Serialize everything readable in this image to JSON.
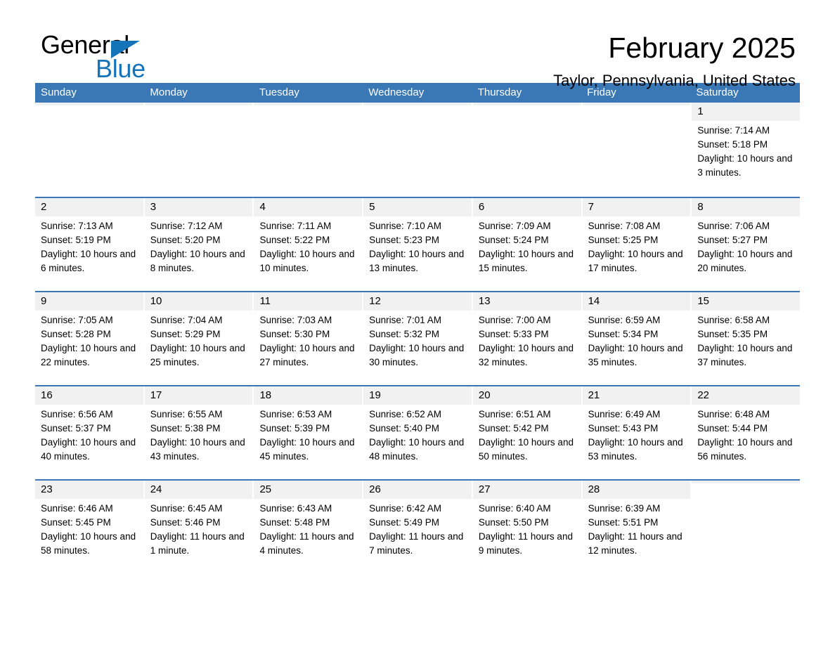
{
  "brand": {
    "name_part1": "General",
    "name_part2": "Blue",
    "accent_color": "#1573b9"
  },
  "header": {
    "title": "February 2025",
    "subtitle": "Taylor, Pennsylvania, United States"
  },
  "calendar": {
    "header_color": "#3a78b5",
    "weekdays": [
      "Sunday",
      "Monday",
      "Tuesday",
      "Wednesday",
      "Thursday",
      "Friday",
      "Saturday"
    ],
    "weeks": [
      [
        {
          "day": "",
          "empty": true
        },
        {
          "day": "",
          "empty": true
        },
        {
          "day": "",
          "empty": true
        },
        {
          "day": "",
          "empty": true
        },
        {
          "day": "",
          "empty": true
        },
        {
          "day": "",
          "empty": true
        },
        {
          "day": "1",
          "sunrise": "Sunrise: 7:14 AM",
          "sunset": "Sunset: 5:18 PM",
          "daylight": "Daylight: 10 hours and 3 minutes."
        }
      ],
      [
        {
          "day": "2",
          "sunrise": "Sunrise: 7:13 AM",
          "sunset": "Sunset: 5:19 PM",
          "daylight": "Daylight: 10 hours and 6 minutes."
        },
        {
          "day": "3",
          "sunrise": "Sunrise: 7:12 AM",
          "sunset": "Sunset: 5:20 PM",
          "daylight": "Daylight: 10 hours and 8 minutes."
        },
        {
          "day": "4",
          "sunrise": "Sunrise: 7:11 AM",
          "sunset": "Sunset: 5:22 PM",
          "daylight": "Daylight: 10 hours and 10 minutes."
        },
        {
          "day": "5",
          "sunrise": "Sunrise: 7:10 AM",
          "sunset": "Sunset: 5:23 PM",
          "daylight": "Daylight: 10 hours and 13 minutes."
        },
        {
          "day": "6",
          "sunrise": "Sunrise: 7:09 AM",
          "sunset": "Sunset: 5:24 PM",
          "daylight": "Daylight: 10 hours and 15 minutes."
        },
        {
          "day": "7",
          "sunrise": "Sunrise: 7:08 AM",
          "sunset": "Sunset: 5:25 PM",
          "daylight": "Daylight: 10 hours and 17 minutes."
        },
        {
          "day": "8",
          "sunrise": "Sunrise: 7:06 AM",
          "sunset": "Sunset: 5:27 PM",
          "daylight": "Daylight: 10 hours and 20 minutes."
        }
      ],
      [
        {
          "day": "9",
          "sunrise": "Sunrise: 7:05 AM",
          "sunset": "Sunset: 5:28 PM",
          "daylight": "Daylight: 10 hours and 22 minutes."
        },
        {
          "day": "10",
          "sunrise": "Sunrise: 7:04 AM",
          "sunset": "Sunset: 5:29 PM",
          "daylight": "Daylight: 10 hours and 25 minutes."
        },
        {
          "day": "11",
          "sunrise": "Sunrise: 7:03 AM",
          "sunset": "Sunset: 5:30 PM",
          "daylight": "Daylight: 10 hours and 27 minutes."
        },
        {
          "day": "12",
          "sunrise": "Sunrise: 7:01 AM",
          "sunset": "Sunset: 5:32 PM",
          "daylight": "Daylight: 10 hours and 30 minutes."
        },
        {
          "day": "13",
          "sunrise": "Sunrise: 7:00 AM",
          "sunset": "Sunset: 5:33 PM",
          "daylight": "Daylight: 10 hours and 32 minutes."
        },
        {
          "day": "14",
          "sunrise": "Sunrise: 6:59 AM",
          "sunset": "Sunset: 5:34 PM",
          "daylight": "Daylight: 10 hours and 35 minutes."
        },
        {
          "day": "15",
          "sunrise": "Sunrise: 6:58 AM",
          "sunset": "Sunset: 5:35 PM",
          "daylight": "Daylight: 10 hours and 37 minutes."
        }
      ],
      [
        {
          "day": "16",
          "sunrise": "Sunrise: 6:56 AM",
          "sunset": "Sunset: 5:37 PM",
          "daylight": "Daylight: 10 hours and 40 minutes."
        },
        {
          "day": "17",
          "sunrise": "Sunrise: 6:55 AM",
          "sunset": "Sunset: 5:38 PM",
          "daylight": "Daylight: 10 hours and 43 minutes."
        },
        {
          "day": "18",
          "sunrise": "Sunrise: 6:53 AM",
          "sunset": "Sunset: 5:39 PM",
          "daylight": "Daylight: 10 hours and 45 minutes."
        },
        {
          "day": "19",
          "sunrise": "Sunrise: 6:52 AM",
          "sunset": "Sunset: 5:40 PM",
          "daylight": "Daylight: 10 hours and 48 minutes."
        },
        {
          "day": "20",
          "sunrise": "Sunrise: 6:51 AM",
          "sunset": "Sunset: 5:42 PM",
          "daylight": "Daylight: 10 hours and 50 minutes."
        },
        {
          "day": "21",
          "sunrise": "Sunrise: 6:49 AM",
          "sunset": "Sunset: 5:43 PM",
          "daylight": "Daylight: 10 hours and 53 minutes."
        },
        {
          "day": "22",
          "sunrise": "Sunrise: 6:48 AM",
          "sunset": "Sunset: 5:44 PM",
          "daylight": "Daylight: 10 hours and 56 minutes."
        }
      ],
      [
        {
          "day": "23",
          "sunrise": "Sunrise: 6:46 AM",
          "sunset": "Sunset: 5:45 PM",
          "daylight": "Daylight: 10 hours and 58 minutes."
        },
        {
          "day": "24",
          "sunrise": "Sunrise: 6:45 AM",
          "sunset": "Sunset: 5:46 PM",
          "daylight": "Daylight: 11 hours and 1 minute."
        },
        {
          "day": "25",
          "sunrise": "Sunrise: 6:43 AM",
          "sunset": "Sunset: 5:48 PM",
          "daylight": "Daylight: 11 hours and 4 minutes."
        },
        {
          "day": "26",
          "sunrise": "Sunrise: 6:42 AM",
          "sunset": "Sunset: 5:49 PM",
          "daylight": "Daylight: 11 hours and 7 minutes."
        },
        {
          "day": "27",
          "sunrise": "Sunrise: 6:40 AM",
          "sunset": "Sunset: 5:50 PM",
          "daylight": "Daylight: 11 hours and 9 minutes."
        },
        {
          "day": "28",
          "sunrise": "Sunrise: 6:39 AM",
          "sunset": "Sunset: 5:51 PM",
          "daylight": "Daylight: 11 hours and 12 minutes."
        },
        {
          "day": "",
          "empty": true
        }
      ]
    ]
  }
}
